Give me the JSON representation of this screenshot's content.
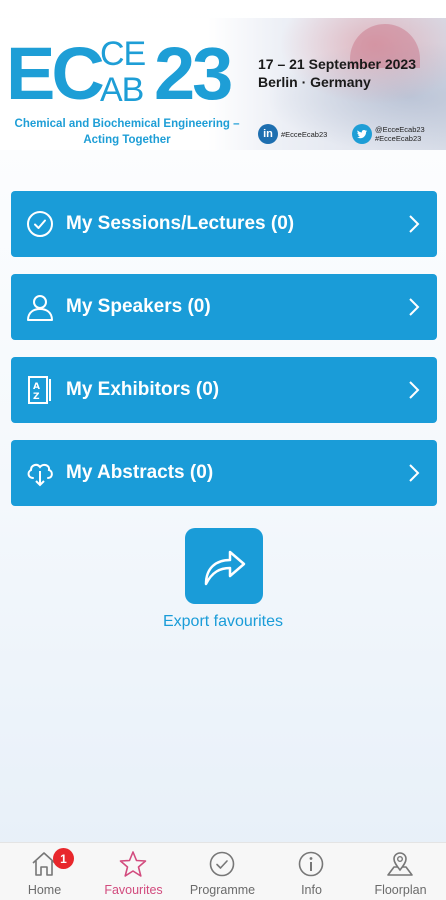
{
  "banner": {
    "logo_ec": "EC",
    "logo_ce": "CE",
    "logo_ab": "AB",
    "logo_year": "23",
    "tagline_line1": "Chemical and Biochemical Engineering –",
    "tagline_line2": "Acting Together",
    "dates": "17 – 21 September 2023",
    "location": "Berlin · Germany",
    "linkedin_handle": "#EcceEcab23",
    "twitter_handle_1": "@EcceEcab23",
    "twitter_handle_2": "#EcceEcab23"
  },
  "menu": [
    {
      "label": "My Sessions/Lectures",
      "count": "0",
      "icon": "clock-icon"
    },
    {
      "label": "My Speakers",
      "count": "0",
      "icon": "user-icon"
    },
    {
      "label": "My Exhibitors",
      "count": "0",
      "icon": "az-list-icon"
    },
    {
      "label": "My Abstracts",
      "count": "0",
      "icon": "cloud-download-icon"
    }
  ],
  "export": {
    "label": "Export favourites",
    "icon": "share-arrow-icon"
  },
  "bottom_nav": {
    "items": [
      {
        "label": "Home",
        "icon": "home-icon",
        "badge": "1"
      },
      {
        "label": "Favourites",
        "icon": "star-icon",
        "active": true
      },
      {
        "label": "Programme",
        "icon": "clock-icon"
      },
      {
        "label": "Info",
        "icon": "info-icon"
      },
      {
        "label": "Floorplan",
        "icon": "map-pin-icon"
      }
    ]
  },
  "colors": {
    "accent": "#1a9cd8",
    "active_tab": "#d24b7e",
    "badge": "#e8272c"
  }
}
